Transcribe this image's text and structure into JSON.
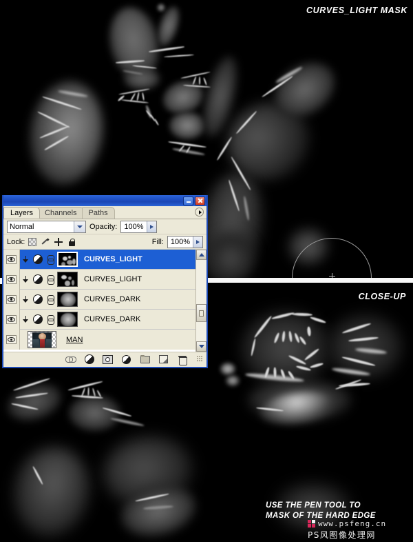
{
  "annotations": {
    "mask_title": "CURVES_LIGHT MASK",
    "closeup_title": "CLOSE-UP",
    "pen_note_line1": "USE THE PEN TOOL TO",
    "pen_note_line2": "MASK OF THE HARD EDGE"
  },
  "watermark": {
    "url": "www.psfeng.cn",
    "site_name": "PS风图像处理网"
  },
  "panel": {
    "tabs": [
      {
        "label": "Layers",
        "active": true
      },
      {
        "label": "Channels",
        "active": false
      },
      {
        "label": "Paths",
        "active": false
      }
    ],
    "blend_mode": "Normal",
    "opacity_label": "Opacity:",
    "opacity_value": "100%",
    "lock_label": "Lock:",
    "fill_label": "Fill:",
    "fill_value": "100%",
    "lock_icons": [
      "transparency-lock-icon",
      "brush-lock-icon",
      "move-lock-icon",
      "lock-all-icon"
    ],
    "window_buttons": [
      "minimize-icon",
      "close-icon"
    ],
    "menu_icon": "panel-menu-icon",
    "layers": [
      {
        "name": "CURVES_LIGHT",
        "selected": true,
        "visible": true,
        "clipped": true,
        "linked": true,
        "type": "adjustment",
        "thumb": "light-mask"
      },
      {
        "name": "CURVES_LIGHT",
        "selected": false,
        "visible": true,
        "clipped": true,
        "linked": true,
        "type": "adjustment",
        "thumb": "light-mask"
      },
      {
        "name": "CURVES_DARK",
        "selected": false,
        "visible": true,
        "clipped": true,
        "linked": true,
        "type": "adjustment",
        "thumb": "dark-mask"
      },
      {
        "name": "CURVES_DARK",
        "selected": false,
        "visible": true,
        "clipped": true,
        "linked": true,
        "type": "adjustment",
        "thumb": "dark-mask"
      },
      {
        "name": "MAN",
        "selected": false,
        "visible": true,
        "clipped": false,
        "linked": false,
        "type": "image",
        "thumb": "man-photo"
      }
    ],
    "footer_icons": [
      "link-layers-icon",
      "layer-style-fx-icon",
      "add-mask-icon",
      "new-adjustment-layer-icon",
      "new-group-icon",
      "new-layer-icon",
      "delete-layer-icon"
    ],
    "scrollbar": {
      "up": "scroll-up-arrow-icon",
      "down": "scroll-down-arrow-icon"
    },
    "resize_grip": "resize-grip-icon"
  },
  "colors": {
    "titlebar_blue": "#1e4fc4",
    "selection_blue": "#1d5fd4",
    "panel_bg": "#ece9d8",
    "canvas_black": "#000000",
    "watermark_pink": "#d8285a"
  }
}
